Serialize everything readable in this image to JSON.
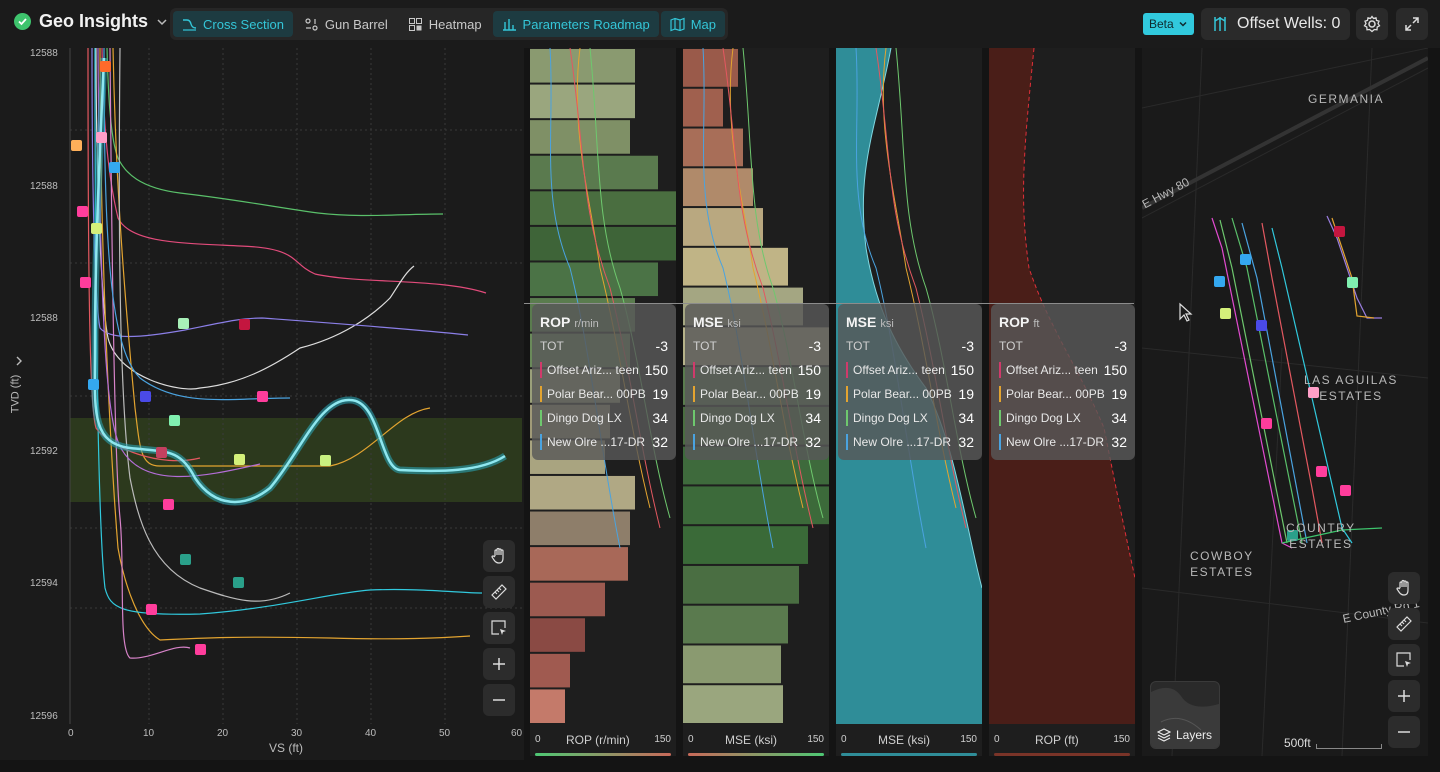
{
  "header": {
    "app_title": "Geo Insights",
    "tabs": [
      {
        "label": "Cross Section",
        "active": true
      },
      {
        "label": "Gun Barrel",
        "active": false
      },
      {
        "label": "Heatmap",
        "active": false
      },
      {
        "label": "Parameters Roadmap",
        "active": true
      },
      {
        "label": "Map",
        "active": true
      }
    ],
    "beta_label": "Beta",
    "offset_wells_label": "Offset Wells: 0"
  },
  "cross_section": {
    "y_axis_label": "TVD (ft)",
    "y_ticks": [
      "12588",
      "12588",
      "12588",
      "12592",
      "12594",
      "12596"
    ],
    "x_axis_label": "VS (ft)",
    "x_ticks": [
      "0",
      "10",
      "20",
      "30",
      "40",
      "50",
      "60"
    ]
  },
  "tracks": [
    {
      "title": "ROP",
      "unit": "r/min",
      "footer": "ROP (r/min)",
      "min": "0",
      "max": "150",
      "tot_label": "TOT",
      "tot_value": "-3"
    },
    {
      "title": "MSE",
      "unit": "ksi",
      "footer": "MSE (ksi)",
      "min": "0",
      "max": "150",
      "tot_label": "TOT",
      "tot_value": "-3"
    },
    {
      "title": "MSE",
      "unit": "ksi",
      "footer": "MSE (ksi)",
      "min": "0",
      "max": "150",
      "tot_label": "TOT",
      "tot_value": "-3"
    },
    {
      "title": "ROP",
      "unit": "ft",
      "footer": "ROP (ft)",
      "min": "0",
      "max": "150",
      "tot_label": "TOT",
      "tot_value": "-3"
    }
  ],
  "tooltip_rows": [
    {
      "name": "Offset Ariz... teen",
      "value": "150",
      "color": "#d03a6b"
    },
    {
      "name": "Polar Bear... 00PB",
      "value": "19",
      "color": "#e3a430"
    },
    {
      "name": "Dingo Dog LX",
      "value": "34",
      "color": "#6ec86e"
    },
    {
      "name": "New Olre ...17-DR",
      "value": "32",
      "color": "#4aa3e0"
    }
  ],
  "map": {
    "labels": [
      "GERMANIA",
      "E Hwy 80",
      "LAS AGUILAS\nESTATES",
      "COUNTRY\nESTATES",
      "COWBOY\nESTATES",
      "E County Rd 1"
    ],
    "scale_label": "500ft",
    "layers_label": "Layers"
  },
  "colors": {
    "accent": "#31c9dd",
    "ok": "#3ec46d",
    "target_zone": "#2f3d1e"
  }
}
